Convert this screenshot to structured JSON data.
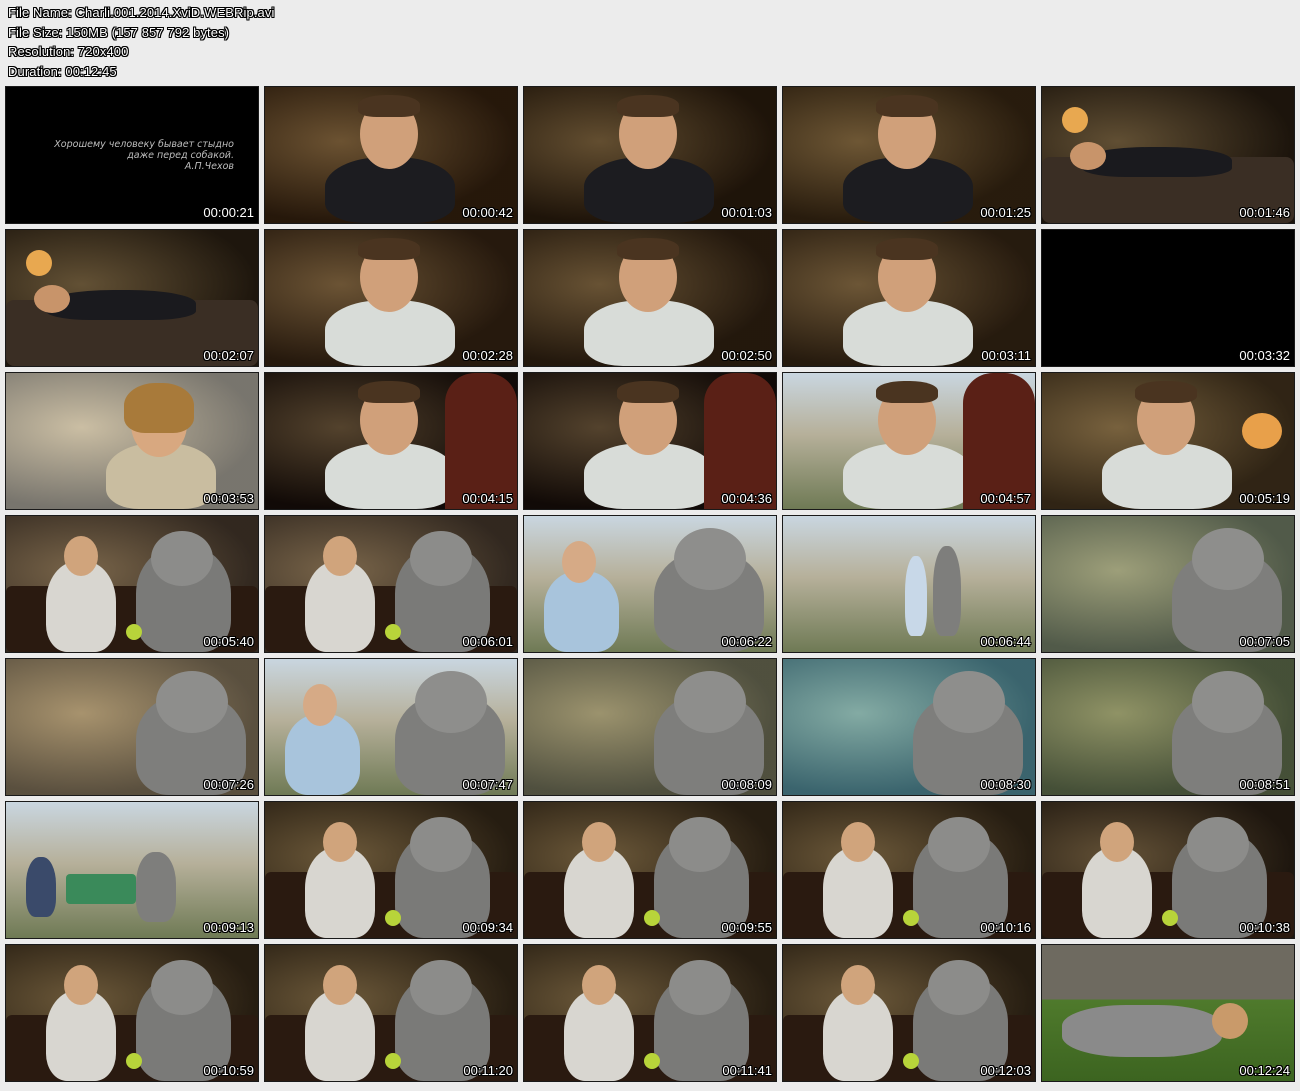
{
  "info": {
    "file_name": "File Name: Charli.001.2014.XviD.WEBRip.avi",
    "file_size": "File Size: 150MB (157 857 792 bytes)",
    "resolution": "Resolution: 720x400",
    "duration": "Duration: 00:12:45"
  },
  "quote": {
    "line1": "Хорошему человеку бывает стыдно",
    "line2": "даже перед собакой.",
    "line3": "А.П.Чехов"
  },
  "thumbnails": [
    {
      "time": "00:00:21",
      "bg": "#000000",
      "subject": "title-card"
    },
    {
      "time": "00:00:42",
      "bg": "#3a2410",
      "subject": "man-in-suit"
    },
    {
      "time": "00:01:03",
      "bg": "#2e1e0e",
      "subject": "man-in-suit"
    },
    {
      "time": "00:01:25",
      "bg": "#3d2a14",
      "subject": "man-drinking"
    },
    {
      "time": "00:01:46",
      "bg": "#2b1f12",
      "subject": "man-in-bed"
    },
    {
      "time": "00:02:07",
      "bg": "#2e2214",
      "subject": "man-in-bed"
    },
    {
      "time": "00:02:28",
      "bg": "#3a2614",
      "subject": "man-kitchen"
    },
    {
      "time": "00:02:50",
      "bg": "#352413",
      "subject": "man-kitchen"
    },
    {
      "time": "00:03:11",
      "bg": "#3b2916",
      "subject": "man-drinking"
    },
    {
      "time": "00:03:32",
      "bg": "#000000",
      "subject": "black"
    },
    {
      "time": "00:03:53",
      "bg": "#b9b4a8",
      "subject": "woman"
    },
    {
      "time": "00:04:15",
      "bg": "#1a0f0a",
      "subject": "man-doorway"
    },
    {
      "time": "00:04:36",
      "bg": "#1a0f0a",
      "subject": "man-doorway"
    },
    {
      "time": "00:04:57",
      "bg": "#7a6a55",
      "subject": "man-door-outside"
    },
    {
      "time": "00:05:19",
      "bg": "#4a3820",
      "subject": "man-lamp"
    },
    {
      "time": "00:05:40",
      "bg": "#4c3d30",
      "subject": "dog-couch"
    },
    {
      "time": "00:06:01",
      "bg": "#4c3d30",
      "subject": "dog-couch"
    },
    {
      "time": "00:06:22",
      "bg": "#8c8a80",
      "subject": "man-and-dog"
    },
    {
      "time": "00:06:44",
      "bg": "#9aa0a0",
      "subject": "street-walk"
    },
    {
      "time": "00:07:05",
      "bg": "#7c8a70",
      "subject": "dog-closeup"
    },
    {
      "time": "00:07:26",
      "bg": "#8a7a60",
      "subject": "dog-closeup"
    },
    {
      "time": "00:07:47",
      "bg": "#b8c8d6",
      "subject": "man-and-dog-standing"
    },
    {
      "time": "00:08:09",
      "bg": "#7a7a60",
      "subject": "dog-table"
    },
    {
      "time": "00:08:30",
      "bg": "#5a9aa8",
      "subject": "dog-woman"
    },
    {
      "time": "00:08:51",
      "bg": "#6a7a55",
      "subject": "dog-table"
    },
    {
      "time": "00:09:13",
      "bg": "#8aa0b0",
      "subject": "cafe-outdoor"
    },
    {
      "time": "00:09:34",
      "bg": "#3a2c1a",
      "subject": "couch-duo"
    },
    {
      "time": "00:09:55",
      "bg": "#3a2c1a",
      "subject": "couch-duo"
    },
    {
      "time": "00:10:16",
      "bg": "#3a2c1a",
      "subject": "couch-duo"
    },
    {
      "time": "00:10:38",
      "bg": "#2e2216",
      "subject": "couch-action"
    },
    {
      "time": "00:10:59",
      "bg": "#3a2c1a",
      "subject": "couch-duo"
    },
    {
      "time": "00:11:20",
      "bg": "#3a2c1a",
      "subject": "couch-duo"
    },
    {
      "time": "00:11:41",
      "bg": "#3a2c1a",
      "subject": "couch-duo"
    },
    {
      "time": "00:12:03",
      "bg": "#3a2c1a",
      "subject": "couch-duo"
    },
    {
      "time": "00:12:24",
      "bg": "#4a6a30",
      "subject": "lawn"
    }
  ]
}
